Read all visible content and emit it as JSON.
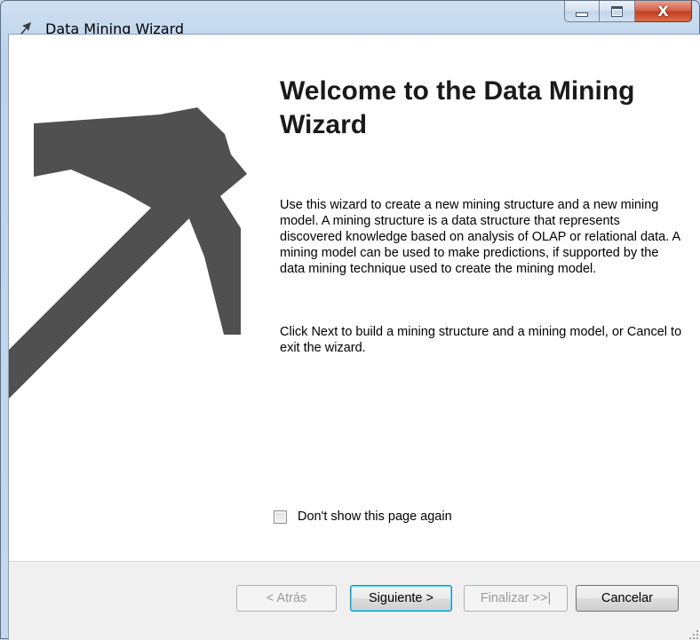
{
  "window": {
    "title": "Data Mining Wizard"
  },
  "caption_buttons": {
    "close_glyph": "X"
  },
  "content": {
    "heading": "Welcome to the Data Mining Wizard",
    "description": "Use this wizard to create a new mining structure and a new mining model. A mining structure is a data structure that represents discovered knowledge based on analysis of OLAP or relational data.  A mining model can be used to make predictions, if supported by the data mining technique used to create the mining model.",
    "instruction": "Click Next to build a mining structure and a mining model, or Cancel to exit the wizard."
  },
  "options": {
    "dont_show_label": "Don't show this page again",
    "dont_show_checked": false
  },
  "buttons": {
    "back_label": "< Atrás",
    "next_label": "Siguiente >",
    "finish_label": "Finalizar >>|",
    "cancel_label": "Cancelar"
  },
  "colors": {
    "graphic": "#505050",
    "title_bar": "#c9d9ea",
    "close_button": "#c2401f"
  },
  "icons": {
    "app": "pickaxe-icon",
    "minimize": "minimize-icon",
    "maximize": "maximize-icon",
    "close": "close-icon"
  }
}
